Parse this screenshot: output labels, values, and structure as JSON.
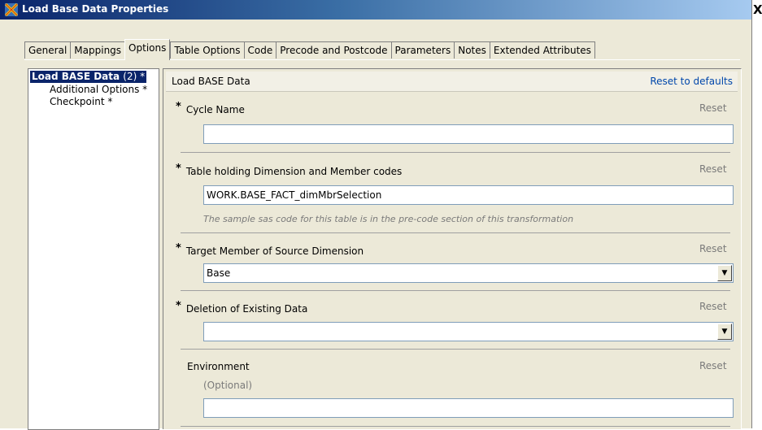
{
  "window": {
    "title": "Load Base Data Properties",
    "close_glyph": "X"
  },
  "tabs": [
    {
      "label": "General"
    },
    {
      "label": "Mappings"
    },
    {
      "label": "Options",
      "active": true
    },
    {
      "label": "Table Options"
    },
    {
      "label": "Code"
    },
    {
      "label": "Precode and Postcode"
    },
    {
      "label": "Parameters"
    },
    {
      "label": "Notes"
    },
    {
      "label": "Extended Attributes"
    }
  ],
  "tree": {
    "selected": "Load BASE Data",
    "selected_count": "(2) *",
    "items": [
      {
        "label": "Additional Options *"
      },
      {
        "label": "Checkpoint *"
      }
    ]
  },
  "panel": {
    "title": "Load BASE Data",
    "reset_all_label": "Reset to defaults",
    "required_marker": "*",
    "fields": [
      {
        "label": "Cycle Name",
        "required": true,
        "reset": "Reset",
        "value": ""
      },
      {
        "label": "Table holding Dimension and Member codes",
        "required": true,
        "reset": "Reset",
        "value": "WORK.BASE_FACT_dimMbrSelection",
        "hint": "The sample sas code for this table is in the pre-code section of this transformation"
      },
      {
        "label": "Target Member of Source Dimension",
        "required": true,
        "reset": "Reset",
        "value": "Base"
      },
      {
        "label": "Deletion of Existing Data",
        "required": true,
        "reset": "Reset",
        "value": ""
      },
      {
        "label": "Environment",
        "required": false,
        "reset": "Reset",
        "optional": "(Optional)",
        "value": ""
      }
    ]
  }
}
